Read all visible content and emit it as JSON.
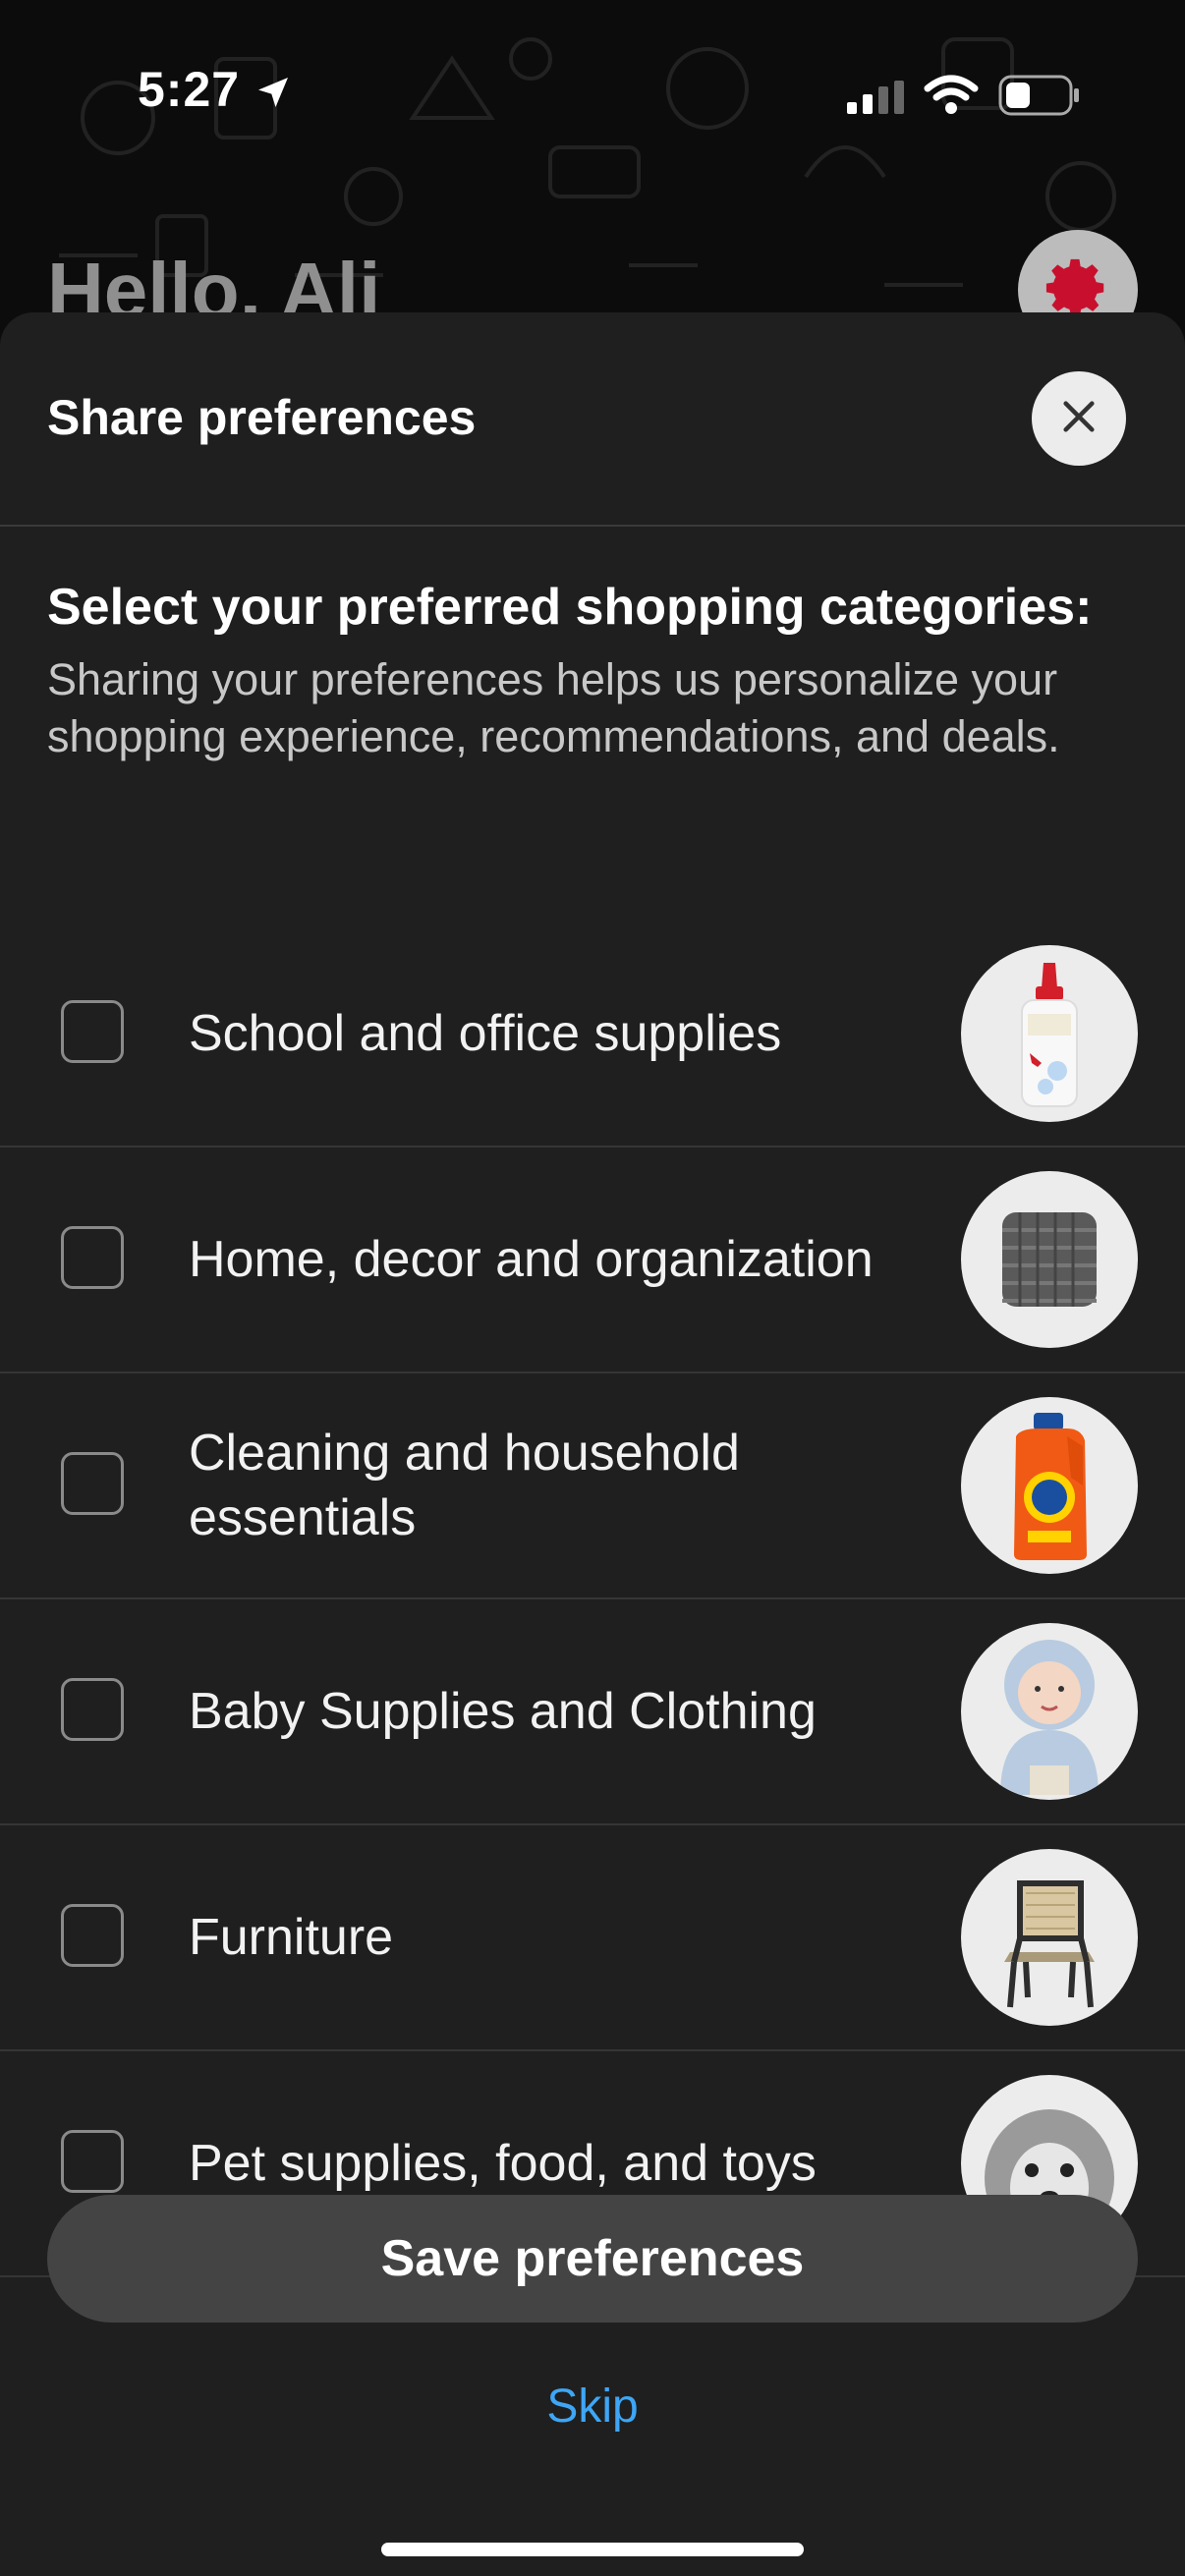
{
  "status_bar": {
    "time": "5:27",
    "icons": [
      "location-arrow-icon",
      "cellular-signal-icon",
      "wifi-icon",
      "battery-icon"
    ]
  },
  "background": {
    "greeting": "Hello, Ali",
    "settings_icon": "gear-icon",
    "accent_color": "#c8102e"
  },
  "sheet": {
    "title": "Share preferences",
    "close_icon": "close-icon",
    "heading": "Select your preferred shopping categories:",
    "description": "Sharing your preferences helps us personalize your shopping experience, recommendations, and deals.",
    "categories": [
      {
        "label": "School and office supplies",
        "checked": false,
        "image": "glue-bottle-image"
      },
      {
        "label": "Home, decor and organization",
        "checked": false,
        "image": "knit-pillow-image"
      },
      {
        "label": "Cleaning and household essentials",
        "checked": false,
        "image": "detergent-bottle-image"
      },
      {
        "label": "Baby Supplies and Clothing",
        "checked": false,
        "image": "baby-image"
      },
      {
        "label": "Furniture",
        "checked": false,
        "image": "chair-image"
      },
      {
        "label": "Pet supplies, food, and toys",
        "checked": false,
        "image": "dog-image"
      }
    ],
    "save_label": "Save preferences",
    "skip_label": "Skip"
  }
}
